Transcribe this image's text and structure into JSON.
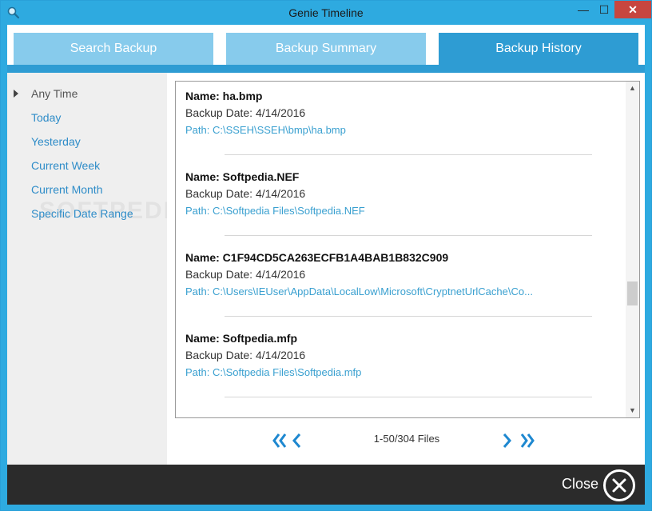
{
  "window": {
    "title": "Genie Timeline",
    "min_glyph": "—",
    "max_glyph": "☐",
    "close_glyph": "✕"
  },
  "tabs": [
    {
      "label": "Search Backup",
      "active": false
    },
    {
      "label": "Backup Summary",
      "active": false
    },
    {
      "label": "Backup History",
      "active": true
    }
  ],
  "sidebar": {
    "items": [
      {
        "label": "Any Time",
        "active": true
      },
      {
        "label": "Today",
        "active": false
      },
      {
        "label": "Yesterday",
        "active": false
      },
      {
        "label": "Current Week",
        "active": false
      },
      {
        "label": "Current Month",
        "active": false
      },
      {
        "label": "Specific Date Range",
        "active": false
      }
    ],
    "watermark": "SOFTPEDIA"
  },
  "files": [
    {
      "name_label": "Name: ha.bmp",
      "date_label": "Backup Date: 4/14/2016",
      "path_label": "Path: C:\\SSEH\\SSEH\\bmp\\ha.bmp"
    },
    {
      "name_label": "Name: Softpedia.NEF",
      "date_label": "Backup Date: 4/14/2016",
      "path_label": "Path: C:\\Softpedia Files\\Softpedia.NEF"
    },
    {
      "name_label": "Name: C1F94CD5CA263ECFB1A4BAB1B832C909",
      "date_label": "Backup Date: 4/14/2016",
      "path_label": "Path: C:\\Users\\IEUser\\AppData\\LocalLow\\Microsoft\\CryptnetUrlCache\\Co..."
    },
    {
      "name_label": "Name: Softpedia.mfp",
      "date_label": "Backup Date: 4/14/2016",
      "path_label": "Path: C:\\Softpedia Files\\Softpedia.mfp"
    }
  ],
  "pager": {
    "label": "1-50/304 Files"
  },
  "footer": {
    "close_label": "Close"
  },
  "colors": {
    "accent": "#2e9cd3",
    "link": "#3aa0d0",
    "footer": "#2b2b2b"
  }
}
